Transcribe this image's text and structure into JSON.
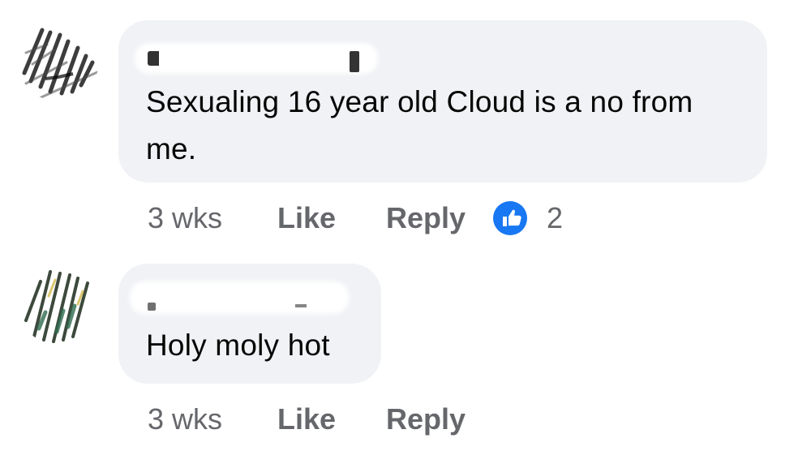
{
  "comments": [
    {
      "author": "",
      "text": "Sexualing 16 year old Cloud is a no from me.",
      "timestamp": "3 wks",
      "like_label": "Like",
      "reply_label": "Reply",
      "reaction_icon": "like-icon",
      "reaction_count": "2"
    },
    {
      "author": "",
      "text": "Holy moly hot",
      "timestamp": "3 wks",
      "like_label": "Like",
      "reply_label": "Reply"
    }
  ],
  "colors": {
    "bubble_background": "#f0f2f5",
    "secondary_text": "#65676b",
    "like_reaction": "#1877f2"
  }
}
